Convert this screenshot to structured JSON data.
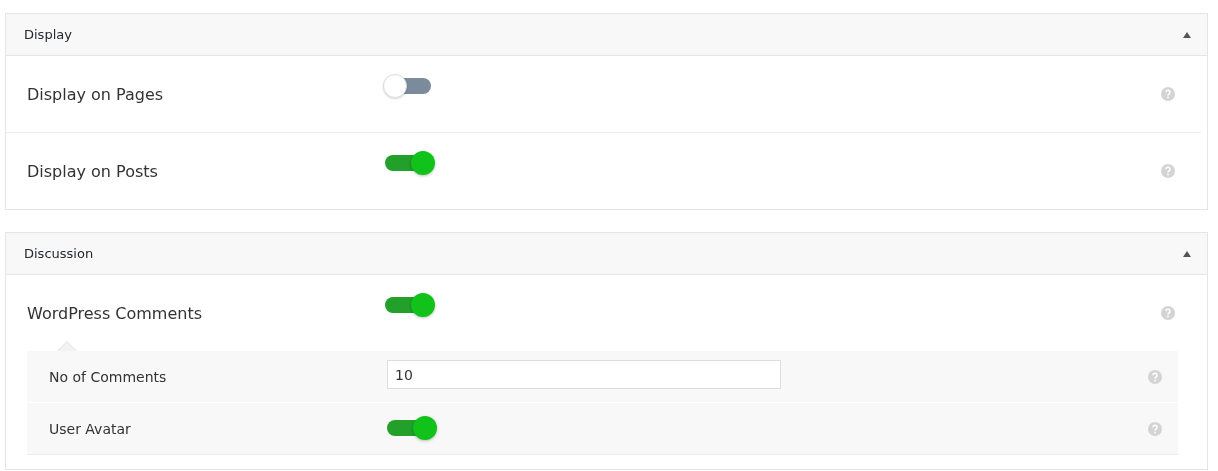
{
  "sections": [
    {
      "title": "Display",
      "expanded": true,
      "rows": [
        {
          "kind": "toggle",
          "label": "Display on Pages",
          "on": false
        },
        {
          "kind": "toggle",
          "label": "Display on Posts",
          "on": true
        }
      ]
    },
    {
      "title": "Discussion",
      "expanded": true,
      "rows": [
        {
          "kind": "toggle",
          "label": "WordPress Comments",
          "on": true,
          "children": [
            {
              "kind": "number",
              "label": "No of Comments",
              "value": "10"
            },
            {
              "kind": "toggle",
              "label": "User Avatar",
              "on": true
            }
          ]
        }
      ]
    }
  ]
}
